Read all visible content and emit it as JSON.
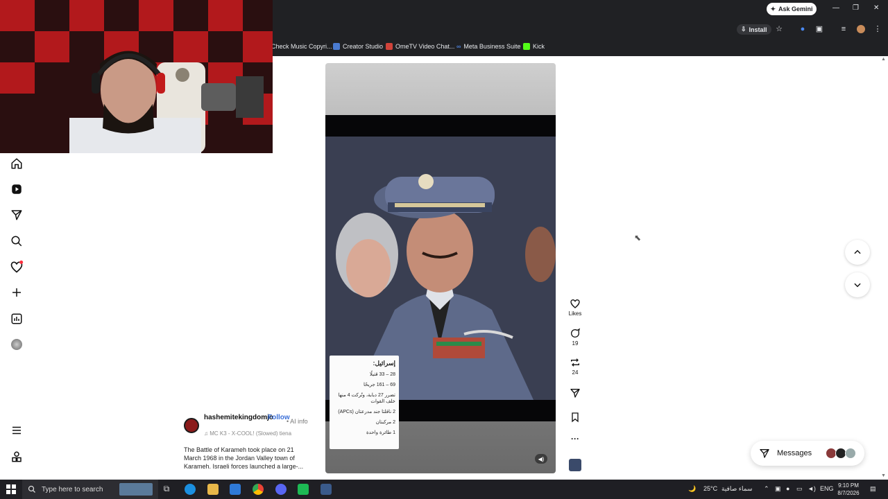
{
  "browser": {
    "ask_gemini": "Ask Gemini",
    "install": "Install",
    "bookmarks": [
      {
        "label": "Check Music Copyri...",
        "color": "#9aa0a6"
      },
      {
        "label": "Creator Studio",
        "color": "#4a7bd0"
      },
      {
        "label": "OmeTV Video Chat...",
        "color": "#d0433a"
      },
      {
        "label": "Meta Business Suite",
        "color": "#4a7bd0"
      },
      {
        "label": "Kick",
        "color": "#53fc18"
      }
    ]
  },
  "left_nav": {
    "items": [
      "home-icon",
      "reels-icon",
      "send-icon",
      "search-icon",
      "notifications-icon",
      "create-icon",
      "dashboard-icon",
      "profile-avatar"
    ],
    "bottom": [
      "menu-icon",
      "more-apps-icon"
    ]
  },
  "post": {
    "overlay_card": {
      "heading": "إسرائيل:",
      "rows": [
        "28 – 33 قتيلًا",
        "69 – 161 جريحًا",
        "تضرر 27 دبابة، وتُركت 4 منها خلف القوات",
        "2 ناقلتا جند مدرعتان (APCs)",
        "2 مركبتان",
        "1 طائرة واحدة"
      ]
    },
    "username": "hashemitekingdomjo",
    "follow": "Follow",
    "ai_info": "• AI info",
    "music": "MC K3 - X-COOL! (Slowed)   tiena",
    "caption": "The Battle of Karameh took place on 21 March 1968 in the Jordan Valley town of Karameh. Israeli forces launched a large-..."
  },
  "actions": {
    "likes_label": "Likes",
    "comments": "19",
    "reposts": "24"
  },
  "messages_label": "Messages",
  "taskbar": {
    "search_placeholder": "Type here to search",
    "weather": "25°C",
    "weather_desc": "سماء صافية",
    "lang": "ENG",
    "time": "9:10 PM",
    "date": "8/7/2026"
  }
}
